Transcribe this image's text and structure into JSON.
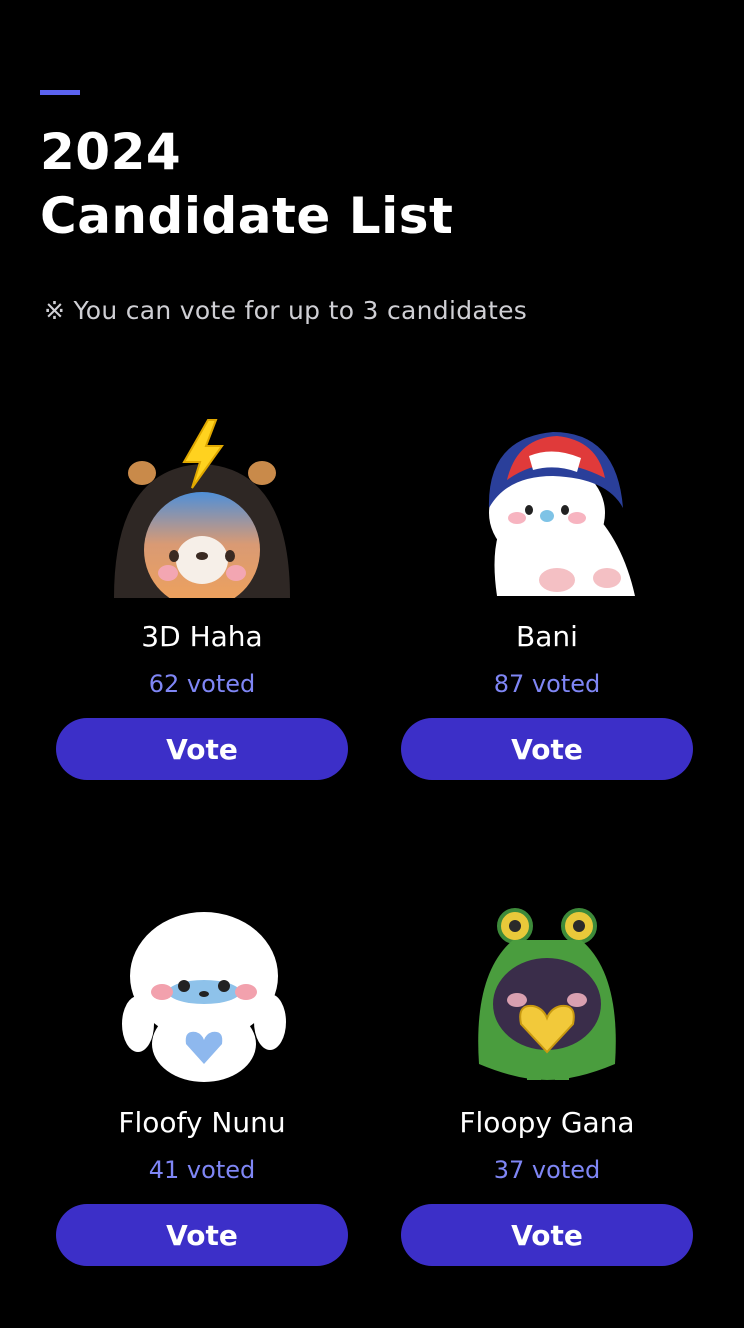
{
  "header": {
    "title_line1": "2024",
    "title_line2": "Candidate List",
    "notice": "※ You can vote for up to 3 candidates"
  },
  "colors": {
    "background": "#000000",
    "accent": "#5b63f0",
    "vote_button": "#3c2fc8",
    "vote_count_text": "#7f86f5"
  },
  "candidates": [
    {
      "name": "3D Haha",
      "votes": "62 voted",
      "button_label": "Vote",
      "icon": "brown-bear-lightning-icon"
    },
    {
      "name": "Bani",
      "votes": "87 voted",
      "button_label": "Vote",
      "icon": "white-bunny-red-cap-icon"
    },
    {
      "name": "Floofy Nunu",
      "votes": "41 voted",
      "button_label": "Vote",
      "icon": "fluffy-white-seal-icon"
    },
    {
      "name": "Floopy Gana",
      "votes": "37 voted",
      "button_label": "Vote",
      "icon": "green-frog-heart-icon"
    }
  ]
}
